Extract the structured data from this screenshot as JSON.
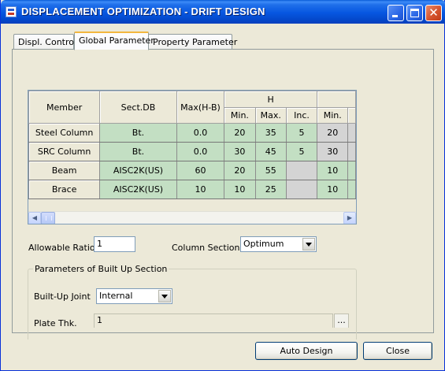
{
  "window": {
    "title": "DISPLACEMENT OPTIMIZATION - DRIFT DESIGN",
    "controls": [
      "minimize",
      "maximize",
      "close"
    ],
    "close_glyph": "✕"
  },
  "tabs": [
    {
      "label": "Displ. Control",
      "active": false
    },
    {
      "label": "Global Parameter",
      "active": true
    },
    {
      "label": "Property Parameter",
      "active": false
    }
  ],
  "grid": {
    "headers": {
      "member": "Member",
      "sectdb": "Sect.DB",
      "max": "Max(H-B)",
      "group_h": "H",
      "min": "Min.",
      "maxcol": "Max.",
      "inc": "Inc.",
      "min2": "Min."
    },
    "rows": [
      {
        "member": "Steel Column",
        "sectdb": "Bt.",
        "max": "0.0",
        "h_min": "20",
        "h_max": "35",
        "h_inc": "5",
        "b_min": "20"
      },
      {
        "member": "SRC Column",
        "sectdb": "Bt.",
        "max": "0.0",
        "h_min": "30",
        "h_max": "45",
        "h_inc": "5",
        "b_min": "30"
      },
      {
        "member": "Beam",
        "sectdb": "AISC2K(US)",
        "max": "60",
        "h_min": "20",
        "h_max": "55",
        "h_inc": "",
        "b_min": "10"
      },
      {
        "member": "Brace",
        "sectdb": "AISC2K(US)",
        "max": "10",
        "h_min": "10",
        "h_max": "25",
        "h_inc": "",
        "b_min": "10"
      }
    ]
  },
  "allowable_ratio": {
    "label": "Allowable Ratio",
    "value": "1"
  },
  "column_section": {
    "label": "Column Section",
    "value": "Optimum"
  },
  "builtup": {
    "group_title": "Parameters of Built Up Section",
    "joint_label": "Built-Up Joint",
    "joint_value": "Internal",
    "plate_label": "Plate Thk.",
    "plate_value": "1",
    "browse_label": "..."
  },
  "buttons": {
    "auto_design": "Auto Design",
    "close": "Close"
  },
  "scroll_arrows": {
    "left": "◀",
    "right": "▶"
  },
  "colors": {
    "cell_green": "#c3dfc3",
    "cell_grey": "#d4d4d4",
    "title_blue": "#0656e0"
  }
}
